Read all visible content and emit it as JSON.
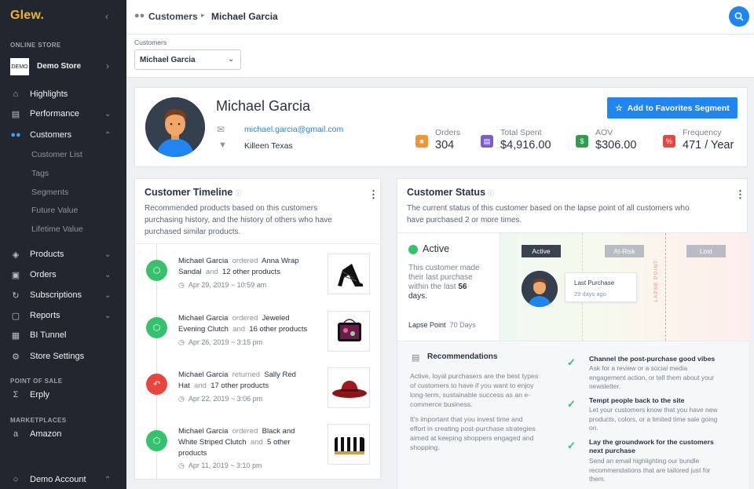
{
  "app": {
    "logo": "Glew."
  },
  "sidebar": {
    "section_online_store": "ONLINE STORE",
    "store_thumb": "DEMO",
    "store_name": "Demo Store",
    "items": [
      {
        "label": "Highlights",
        "icon": "home-icon"
      },
      {
        "label": "Performance",
        "icon": "chart-icon"
      },
      {
        "label": "Customers",
        "icon": "users-icon",
        "active": true
      },
      {
        "label": "Products",
        "icon": "tag-icon"
      },
      {
        "label": "Orders",
        "icon": "inbox-icon"
      },
      {
        "label": "Subscriptions",
        "icon": "refresh-icon"
      },
      {
        "label": "Reports",
        "icon": "document-icon"
      },
      {
        "label": "BI Tunnel",
        "icon": "grid-icon"
      },
      {
        "label": "Store Settings",
        "icon": "gear-icon"
      }
    ],
    "sub_items": [
      "Customer List",
      "Tags",
      "Segments",
      "Future Value",
      "Lifetime Value"
    ],
    "section_pos": "POINT OF SALE",
    "pos_item": "Erply",
    "section_marketplaces": "MARKETPLACES",
    "market_item": "Amazon",
    "account": "Demo Account"
  },
  "topbar": {
    "crumb_1": "Customers",
    "crumb_2": "Michael Garcia"
  },
  "selector": {
    "label": "Customers",
    "value": "Michael Garcia"
  },
  "profile": {
    "name": "Michael Garcia",
    "email": "michael.garcia@gmail.com",
    "location": "Killeen Texas",
    "favorite_button": "Add to Favorites Segment",
    "stats": [
      {
        "label": "Orders",
        "value": "304",
        "color": "#f0952f"
      },
      {
        "label": "Total Spent",
        "value": "$4,916.00",
        "color": "#7b5cc9"
      },
      {
        "label": "AOV",
        "value": "$306.00",
        "color": "#2f9c4f"
      },
      {
        "label": "Frequency",
        "value": "471 / Year",
        "color": "#e8453c"
      }
    ]
  },
  "timeline": {
    "title": "Customer Timeline",
    "description_1": "Recommended products based on this customers",
    "description_2": "purchasing history, and the history of others who have",
    "description_3": "purchased similar products.",
    "entries": [
      {
        "name": "Michael Garcia",
        "action": "ordered",
        "product": "Anna Wrap",
        "product_2": "Sandal",
        "and": "and",
        "others": "12 other products",
        "date": "Apr 29, 2019 ~ 10:59 am",
        "color": "#35c26b"
      },
      {
        "name": "Michael Garcia",
        "action": "ordered",
        "product": "Jeweled",
        "product_2": "Evening Clutch",
        "and": "and",
        "others": "16 other products",
        "date": "Apr 26, 2019 ~ 3:15 pm",
        "color": "#35c26b"
      },
      {
        "name": "Michael Garcia",
        "action": "returned",
        "product": "Sally Red",
        "product_2": "Hat",
        "and": "and",
        "others": "17 other products",
        "date": "Apr 22, 2019 ~ 3:06 pm",
        "color": "#e8453c"
      },
      {
        "name": "Michael Garcia",
        "action": "ordered",
        "product": "Black and",
        "product_2": "White Striped Clutch",
        "and": "and",
        "others": "5 other",
        "others_2": "products",
        "date": "Apr 11, 2019 ~ 3:10 pm",
        "color": "#35c26b"
      }
    ]
  },
  "status": {
    "title": "Customer Status",
    "description_1": "The current status of this customer based on the lapse point of all customers who",
    "description_2": "have purchased 2 or more times.",
    "state": "Active",
    "state_desc_1": "This customer made",
    "state_desc_2": "their last purchase",
    "state_desc_3": "within the last",
    "state_days": "56",
    "state_desc_4": "days.",
    "lapse_label": "Lapse Point",
    "lapse_value": "70 Days",
    "zones": [
      "Active",
      "At-Risk",
      "Lost"
    ],
    "lapse_point_text": "LAPSE POINT",
    "tooltip_title": "Last Purchase",
    "tooltip_sub": "29 days ago"
  },
  "recommendations": {
    "title": "Recommendations",
    "p1": [
      "Active, loyal purchasers are the best types",
      "of customers to have if you want to enjoy",
      "long-term, sustainable success as an e-",
      "commerce business."
    ],
    "p2": [
      "It's important that you invest time and",
      "effort in creating post-purchase strategies",
      "aimed at keeping shoppers engaged and",
      "shopping."
    ],
    "items": [
      {
        "heading": [
          "Channel the post-purchase good vibes"
        ],
        "body": [
          "Ask for a review or a social media",
          "engagement action, or tell them about your",
          "newsletter."
        ]
      },
      {
        "heading": [
          "Tempt people back to the site"
        ],
        "body": [
          "Let your customers know that you have new",
          "products, colors, or a limited time sale going",
          "on."
        ]
      },
      {
        "heading": [
          "Lay the groundwork for the customers",
          "next purchase"
        ],
        "body": [
          "Send an email highlighting our bundle",
          "recommendations that are tailored just for",
          "them."
        ]
      }
    ]
  },
  "colors": {
    "accent": "#1f86f0",
    "sidebar": "#22272f",
    "active_green": "#35c26b",
    "logo": "#f0b323"
  }
}
